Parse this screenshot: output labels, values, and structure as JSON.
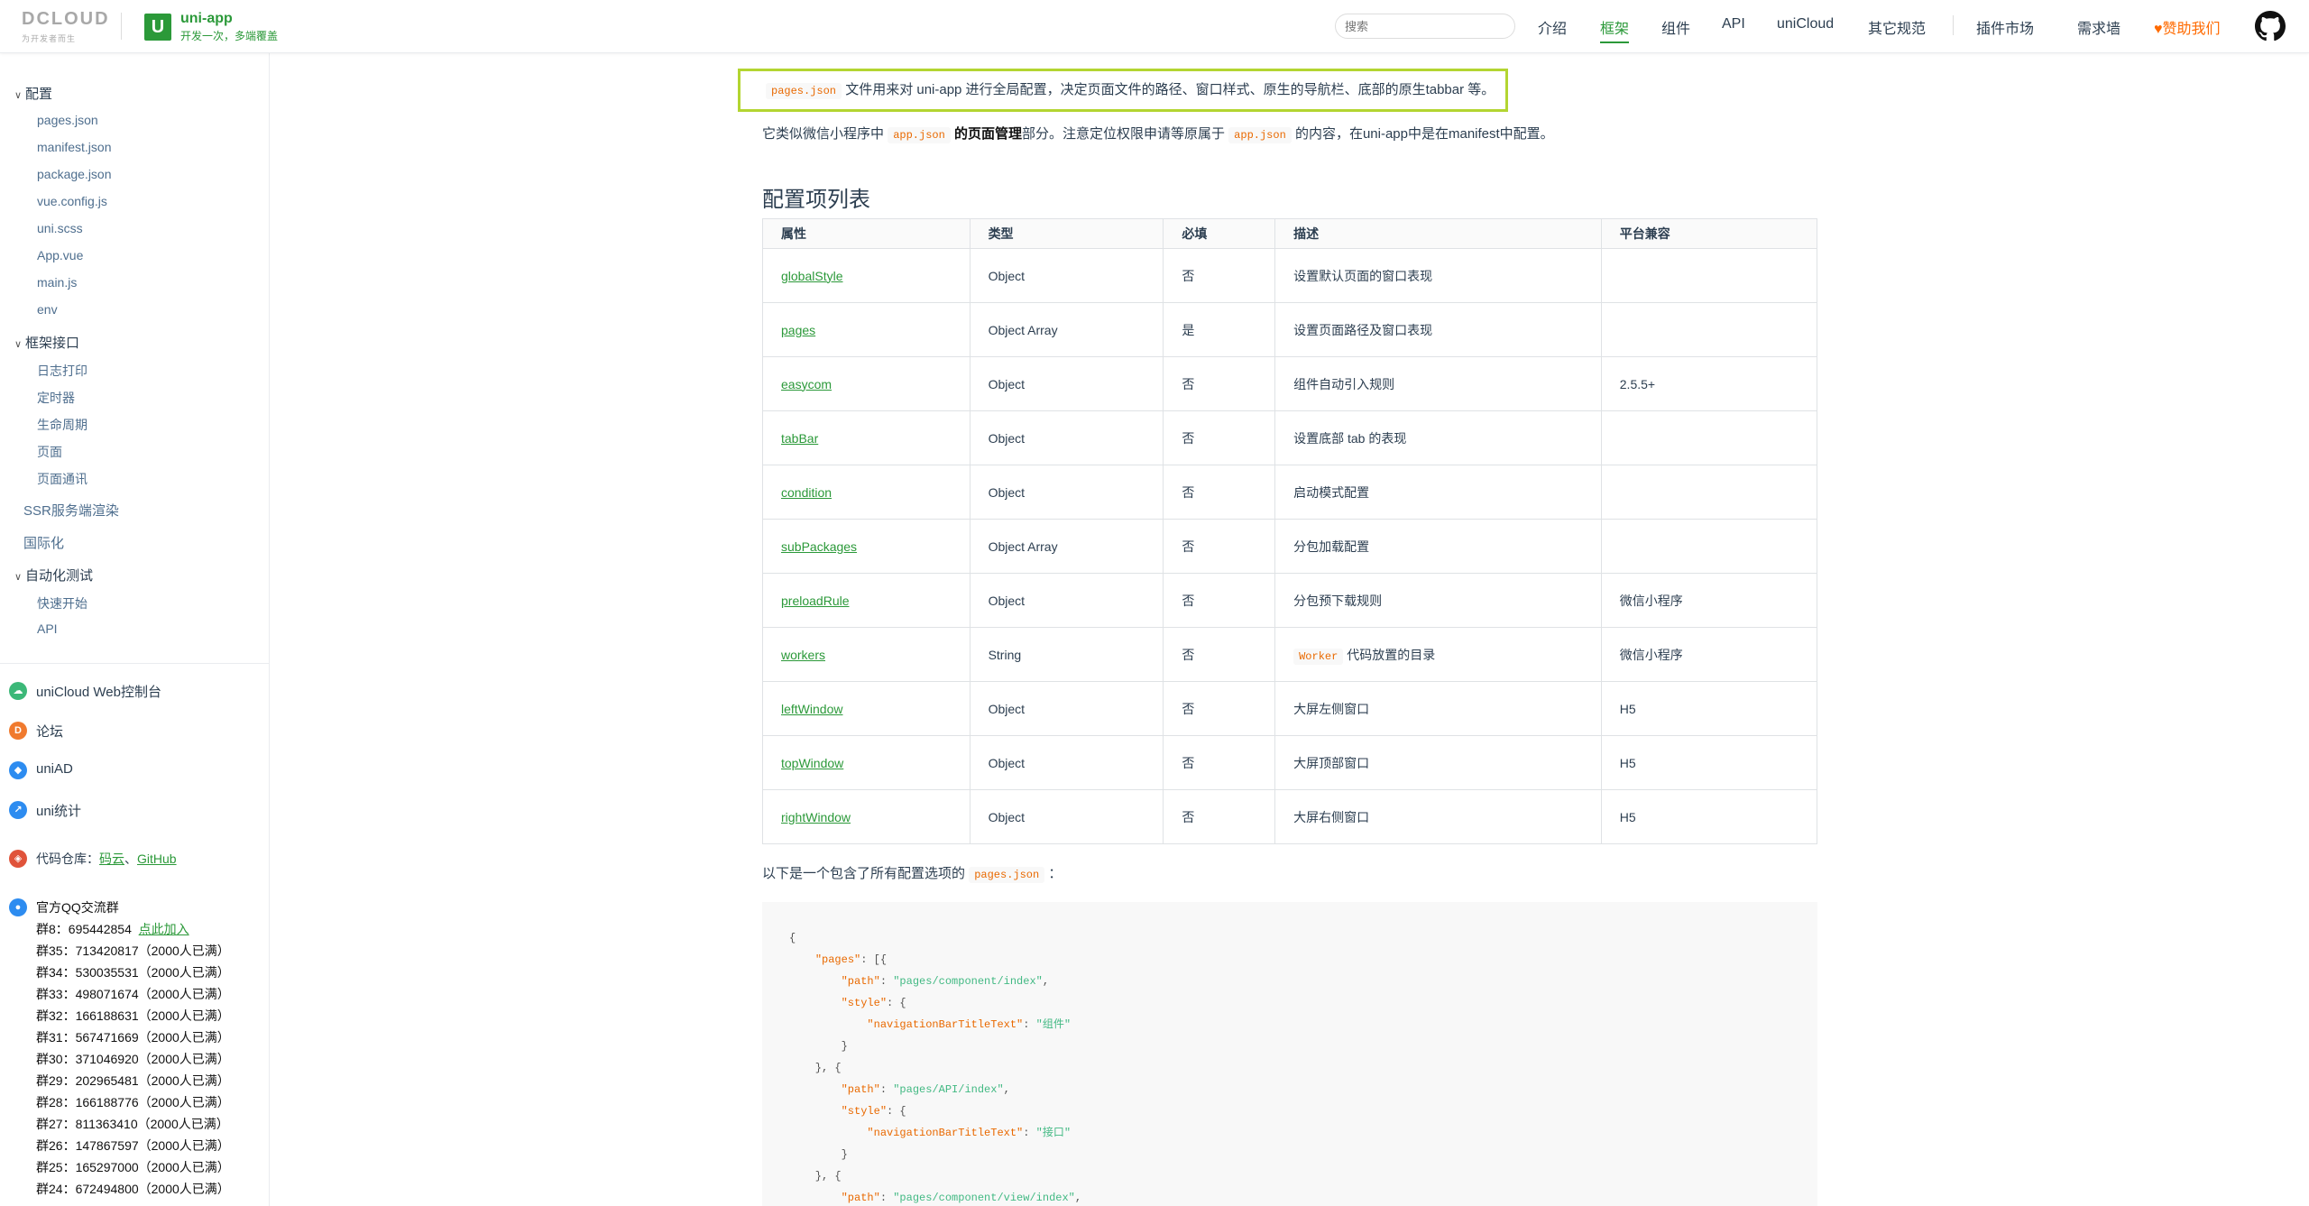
{
  "nav": {
    "dcloud_word": "DCLOUD",
    "dcloud_tag": "为开发者而生",
    "uni_badge": "U",
    "uni_name": "uni-app",
    "uni_slogan": "开发一次，多端覆盖",
    "search_placeholder": "搜索",
    "links": [
      "介绍",
      "框架",
      "组件",
      "API",
      "uniCloud",
      "其它规范",
      "插件市场",
      "需求墙",
      "赞助我们"
    ],
    "active_link": "框架",
    "accent_color": "#2b9939",
    "sponsor_color": "#ff6a00"
  },
  "sidebar": {
    "group_config": "配置",
    "config_items": [
      "pages.json",
      "manifest.json",
      "package.json",
      "vue.config.js",
      "uni.scss",
      "App.vue",
      "main.js",
      "env"
    ],
    "group_framework": "框架接口",
    "framework_items": [
      "日志打印",
      "定时器",
      "生命周期",
      "页面",
      "页面通讯"
    ],
    "ssr": "SSR服务端渲染",
    "i18n": "国际化",
    "group_autotest": "自动化测试",
    "autotest_items": [
      "快速开始",
      "API"
    ],
    "links": [
      "uniCloud Web控制台",
      "论坛",
      "uniAD",
      "uni统计"
    ],
    "repo_label": "代码仓库：",
    "repo_gitee": "码云",
    "repo_sep": "、",
    "repo_github": "GitHub",
    "qq_title": "官方QQ交流群",
    "qq_first_label": "群8：695442854",
    "qq_join": "点此加入",
    "qq_groups": [
      "群35：713420817（2000人已满）",
      "群34：530035531（2000人已满）",
      "群33：498071674（2000人已满）",
      "群32：166188631（2000人已满）",
      "群31：567471669（2000人已满）",
      "群30：371046920（2000人已满）",
      "群29：202965481（2000人已满）",
      "群28：166188776（2000人已满）",
      "群27：811363410（2000人已满）",
      "群26：147867597（2000人已满）",
      "群25：165297000（2000人已满）",
      "群24：672494800（2000人已满）"
    ]
  },
  "main": {
    "intro_code": "pages.json",
    "intro_text": "文件用来对 uni-app 进行全局配置，决定页面文件的路径、窗口样式、原生的导航栏、底部的原生tabbar 等。",
    "p2_a": "它类似微信小程序中",
    "p2_code1": "app.json",
    "p2_bold": "的页面管理",
    "p2_b": "部分。注意定位权限申请等原属于",
    "p2_code2": "app.json",
    "p2_c": "的内容，在uni-app中是在manifest中配置。",
    "h2": "配置项列表",
    "table_headers": [
      "属性",
      "类型",
      "必填",
      "描述",
      "平台兼容"
    ],
    "table_rows": [
      [
        "globalStyle",
        "Object",
        "否",
        "设置默认页面的窗口表现",
        ""
      ],
      [
        "pages",
        "Object Array",
        "是",
        "设置页面路径及窗口表现",
        ""
      ],
      [
        "easycom",
        "Object",
        "否",
        "组件自动引入规则",
        "2.5.5+"
      ],
      [
        "tabBar",
        "Object",
        "否",
        "设置底部 tab 的表现",
        ""
      ],
      [
        "condition",
        "Object",
        "否",
        "启动模式配置",
        ""
      ],
      [
        "subPackages",
        "Object Array",
        "否",
        "分包加载配置",
        ""
      ],
      [
        "preloadRule",
        "Object",
        "否",
        "分包预下载规则",
        "微信小程序"
      ],
      [
        "workers",
        "String",
        "否",
        "Worker|代码放置的目录",
        "微信小程序"
      ],
      [
        "leftWindow",
        "Object",
        "否",
        "大屏左侧窗口",
        "H5"
      ],
      [
        "topWindow",
        "Object",
        "否",
        "大屏顶部窗口",
        "H5"
      ],
      [
        "rightWindow",
        "Object",
        "否",
        "大屏右侧窗口",
        "H5"
      ]
    ],
    "p3_text": "以下是一个包含了所有配置选项的",
    "p3_code": "pages.json",
    "p3_colon": "：",
    "code_lines": [
      "{",
      "    \"pages\": [{",
      "        \"path\": \"pages/component/index\",",
      "        \"style\": {",
      "            \"navigationBarTitleText\": \"组件\"",
      "        }",
      "    }, {",
      "        \"path\": \"pages/API/index\",",
      "        \"style\": {",
      "            \"navigationBarTitleText\": \"接口\"",
      "        }",
      "    }, {",
      "        \"path\": \"pages/component/view/index\","
    ]
  }
}
